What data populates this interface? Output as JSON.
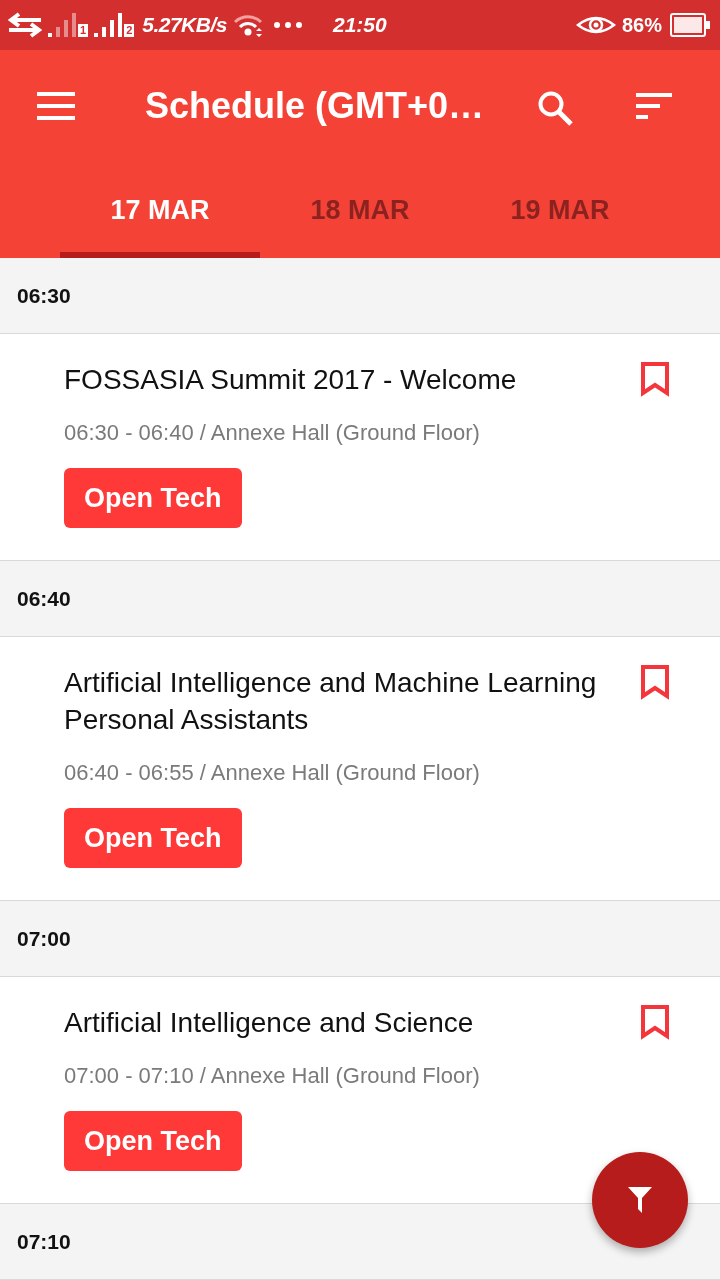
{
  "status_bar": {
    "sim_slots": [
      "1",
      "2"
    ],
    "network_speed": "5.27KB/s",
    "time": "21:50",
    "battery": "86%"
  },
  "app_bar": {
    "title": "Schedule (GMT+0…"
  },
  "tabs": [
    {
      "label": "17 MAR",
      "selected": true
    },
    {
      "label": "18 MAR",
      "selected": false
    },
    {
      "label": "19 MAR",
      "selected": false
    }
  ],
  "schedule": [
    {
      "time": "06:30",
      "sessions": [
        {
          "title": "FOSSASIA Summit 2017 - Welcome",
          "details": "06:30 - 06:40 / Annexe Hall (Ground Floor)",
          "track": "Open Tech",
          "bookmarked": false
        }
      ]
    },
    {
      "time": "06:40",
      "sessions": [
        {
          "title": "Artificial Intelligence and Machine Learning Personal Assistants",
          "details": "06:40 - 06:55 / Annexe Hall (Ground Floor)",
          "track": "Open Tech",
          "bookmarked": false
        }
      ]
    },
    {
      "time": "07:00",
      "sessions": [
        {
          "title": "Artificial Intelligence and Science",
          "details": "07:00 - 07:10 / Annexe Hall (Ground Floor)",
          "track": "Open Tech",
          "bookmarked": false
        }
      ]
    },
    {
      "time": "07:10"
    }
  ]
}
